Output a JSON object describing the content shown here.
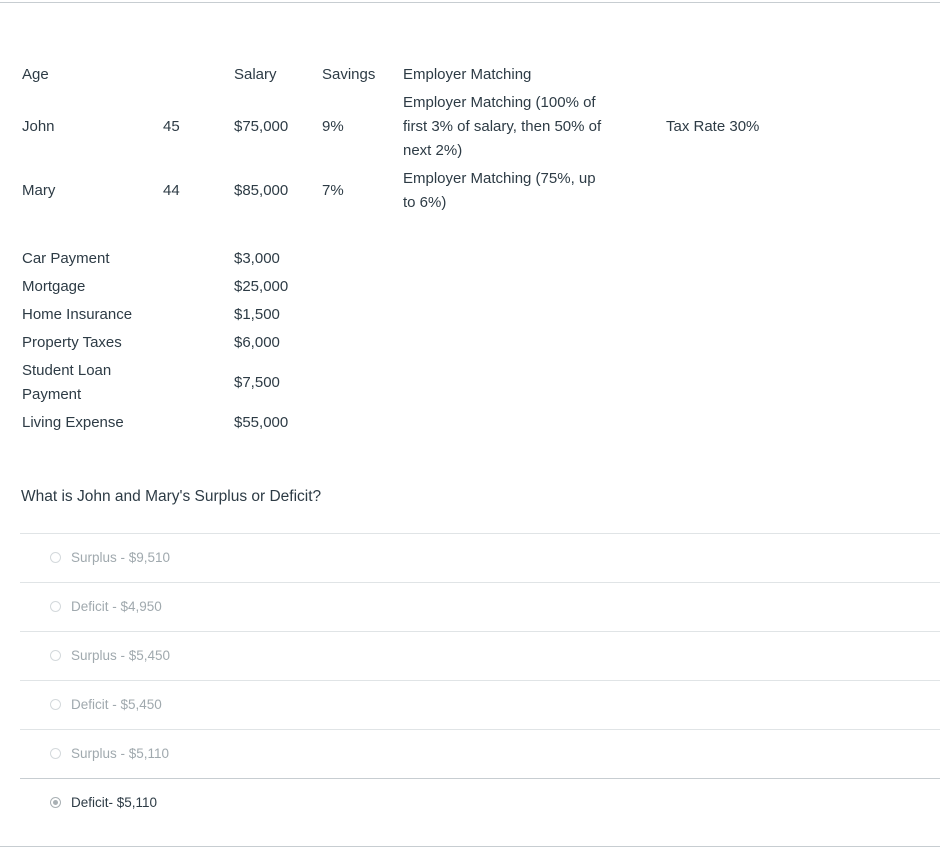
{
  "table": {
    "headers": {
      "age": "Age",
      "salary": "Salary",
      "savings": "Savings",
      "matching": "Employer Matching"
    },
    "people": [
      {
        "name": "John",
        "age": "45",
        "salary": "$75,000",
        "savings": "9%",
        "matching": "Employer Matching (100% of first 3% of salary, then 50% of next 2%)"
      },
      {
        "name": "Mary",
        "age": "44",
        "salary": "$85,000",
        "savings": "7%",
        "matching": "Employer Matching (75%, up to 6%)"
      }
    ],
    "tax_rate": "Tax Rate 30%"
  },
  "expenses": [
    {
      "label": "Car Payment",
      "amount": "$3,000"
    },
    {
      "label": "Mortgage",
      "amount": "$25,000"
    },
    {
      "label": "Home Insurance",
      "amount": "$1,500"
    },
    {
      "label": "Property Taxes",
      "amount": "$6,000"
    },
    {
      "label": "Student Loan Payment",
      "amount": "$7,500"
    },
    {
      "label": "Living Expense",
      "amount": "$55,000"
    }
  ],
  "question": "What is John and Mary's Surplus or Deficit?",
  "answers": [
    {
      "label": "Surplus - $9,510",
      "selected": false
    },
    {
      "label": "Deficit - $4,950",
      "selected": false
    },
    {
      "label": "Surplus - $5,450",
      "selected": false
    },
    {
      "label": "Deficit - $5,450",
      "selected": false
    },
    {
      "label": "Surplus - $5,110",
      "selected": false
    },
    {
      "label": "Deficit- $5,110",
      "selected": true
    }
  ]
}
